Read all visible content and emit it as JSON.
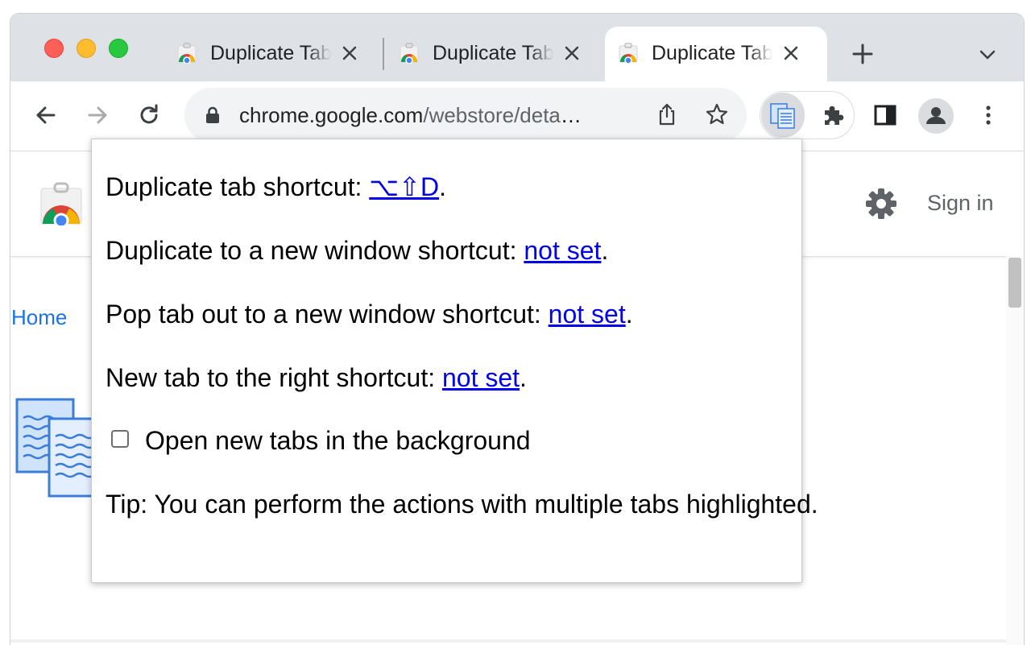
{
  "browser": {
    "tabs": [
      {
        "title": "Duplicate Tab",
        "active": false
      },
      {
        "title": "Duplicate Tab",
        "active": false
      },
      {
        "title": "Duplicate Tab",
        "active": true
      }
    ],
    "url_host": "chrome.google.com",
    "url_path": "/webstore/detai…",
    "icons": {
      "back": "arrow-left-icon",
      "forward": "arrow-right-icon",
      "reload": "reload-icon",
      "lock": "lock-icon",
      "share": "share-icon",
      "bookmark": "star-icon",
      "extension_active": "duplicate-tab-icon",
      "extensions": "puzzle-icon",
      "side_panel": "side-panel-icon",
      "profile": "avatar-icon",
      "menu": "kebab-menu-icon"
    }
  },
  "store": {
    "signin_label": "Sign in",
    "home_label": "Home"
  },
  "popup": {
    "line1_prefix": "Duplicate tab shortcut: ",
    "line1_link": "⌥⇧D",
    "line2_prefix": "Duplicate to a new window shortcut: ",
    "line2_link": "not set",
    "line3_prefix": "Pop tab out to a new window shortcut: ",
    "line3_link": "not set",
    "line4_prefix": "New tab to the right shortcut: ",
    "line4_link": "not set",
    "period": ".",
    "checkbox_label": "Open new tabs in the background",
    "checkbox_checked": false,
    "tip": "Tip: You can perform the actions with multiple tabs highlighted."
  },
  "colors": {
    "tabstrip_bg": "#dee1e6",
    "link": "#0000ee",
    "store_link": "#1a73e8"
  }
}
